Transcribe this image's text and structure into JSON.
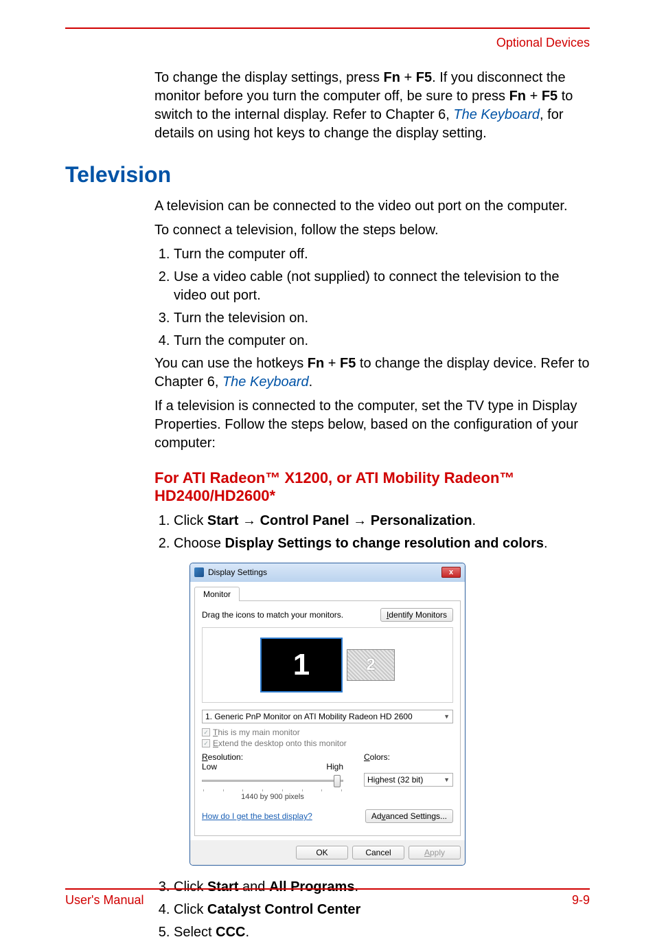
{
  "header": {
    "right": "Optional Devices"
  },
  "intro": {
    "p1a": "To change the display settings, press ",
    "fn": "Fn",
    "plus": " + ",
    "f5": "F5",
    "p1b": ". If you disconnect the monitor before you turn the computer off, be sure to press ",
    "p1c": " to switch to the internal display. Refer to Chapter 6, ",
    "link": "The Keyboard",
    "p1d": ", for details on using hot keys to change the display setting."
  },
  "h1": "Television",
  "tv": {
    "p1": "A television can be connected to the video out port on the computer.",
    "p2": "To connect a television, follow the steps below.",
    "steps": [
      "Turn the computer off.",
      "Use a video cable (not supplied) to connect the television to the video out port.",
      "Turn the television on.",
      "Turn the computer on."
    ],
    "p3a": "You can use the hotkeys ",
    "p3b": " to change the display device. Refer to Chapter 6, ",
    "p3link": "The Keyboard",
    "p3c": ".",
    "p4": "If a television is connected to the computer, set the TV type in Display Properties. Follow the steps below, based on the configuration of your computer:"
  },
  "h2": "For ATI Radeon™ X1200, or ATI Mobility Radeon™ HD2400/HD2600*",
  "ati": {
    "s1a": "Click ",
    "s1b": "Start",
    "arrow": " → ",
    "s1c": "Control Panel",
    "s1d": "Personalization",
    "s1e": ".",
    "s2a": "Choose ",
    "s2b": "Display Settings to change resolution and colors",
    "s2c": ".",
    "s3a": "Click ",
    "s3b": "Start",
    "s3c": " and ",
    "s3d": "All Programs",
    "s3e": ".",
    "s4a": "Click ",
    "s4b": "Catalyst Control Center",
    "s5a": "Select ",
    "s5b": "CCC",
    "s5c": "."
  },
  "dlg": {
    "title": "Display Settings",
    "tab": "Monitor",
    "drag": "Drag the icons to match your monitors.",
    "identify": "Identify Monitors",
    "mon1": "1",
    "mon2": "2",
    "combo": "1. Generic PnP Monitor on ATI Mobility Radeon HD 2600",
    "chk1": "This is my main monitor",
    "chk2": "Extend the desktop onto this monitor",
    "reslabel": "Resolution:",
    "low": "Low",
    "high": "High",
    "resval": "1440 by 900 pixels",
    "clabel": "Colors:",
    "cval": "Highest (32 bit)",
    "help": "How do I get the best display?",
    "adv": "Advanced Settings...",
    "ok": "OK",
    "cancel": "Cancel",
    "apply": "Apply"
  },
  "footer": {
    "left": "User's Manual",
    "right": "9-9"
  }
}
